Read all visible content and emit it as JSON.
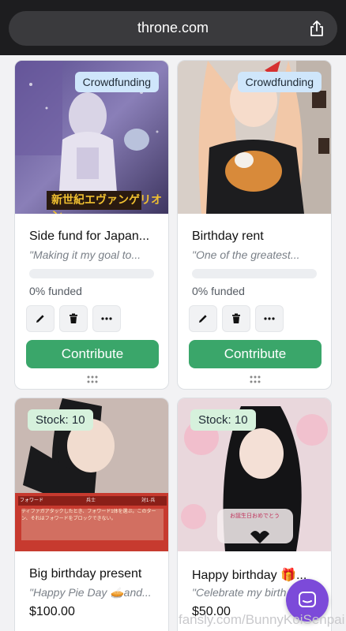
{
  "browser": {
    "url": "throne.com",
    "share_icon": "share-icon"
  },
  "cards": [
    {
      "badge": "Crowdfunding",
      "title": "Side fund for Japan...",
      "description": "\"Making it my goal to...",
      "funded": "0% funded",
      "funded_fraction": 0,
      "contribute": "Contribute"
    },
    {
      "badge": "Crowdfunding",
      "title": "Birthday rent",
      "description": "\"One of the greatest...",
      "funded": "0% funded",
      "funded_fraction": 0,
      "contribute": "Contribute"
    },
    {
      "badge": "Stock: 10",
      "title": "Big birthday present",
      "description": "\"Happy Pie Day 🥧and...",
      "price": "$100.00"
    },
    {
      "badge": "Stock: 10",
      "title": "Happy birthday 🎁...",
      "description": "\"Celebrate my birth...",
      "price": "$50.00"
    }
  ],
  "images": {
    "card1_caption": "新世紀エヴァンゲリオン",
    "card3_tag_left": "フォワード",
    "card3_tag_mid": "兵士",
    "card3_tag_right": "対1·兵",
    "card3_text": "ティファガアタックしたとき、フォワード1体を選ぶ。このターン、それはフォワードをブロックできない。",
    "card4_caption": "お誕生日おめでとう"
  },
  "icons": {
    "edit": "pencil-icon",
    "delete": "trash-icon",
    "more": "more-icon",
    "drag": "drag-handle-icon",
    "chat": "chat-icon"
  },
  "watermark": "fansly.com/BunnyKoiSenpai",
  "colors": {
    "contribute": "#3aa66a",
    "crowdfunding_badge": "#cfe6fb",
    "stock_badge": "#d6f1dc",
    "chat": "#7c4ad9"
  }
}
